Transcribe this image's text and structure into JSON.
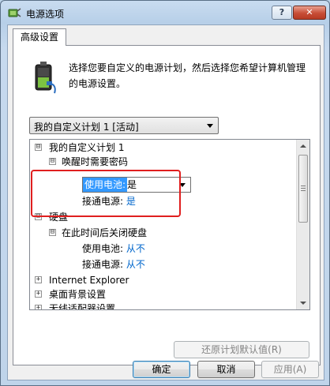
{
  "window": {
    "title": "电源选项",
    "help_label": "?",
    "close_label": "✕"
  },
  "tabs": [
    {
      "label": "高级设置"
    }
  ],
  "description": "选择您要自定义的电源计划，然后选择您希望计算机管理的电源设置。",
  "plan_dropdown": {
    "selected": "我的自定义计划 1 [活动]"
  },
  "tree": {
    "plan": {
      "label": "我的自定义计划 1",
      "expander": "⊟"
    },
    "wake_password": {
      "label": "唤醒时需要密码",
      "battery_label": "使用电池:",
      "battery_value": "是",
      "plugged_label": "接通电源:",
      "plugged_value": "是"
    },
    "hard_disk": {
      "label": "硬盘"
    },
    "disk_off": {
      "label": "在此时间后关闭硬盘",
      "battery_label": "使用电池:",
      "battery_value": "从不",
      "plugged_label": "接通电源:",
      "plugged_value": "从不"
    },
    "collapsed": [
      {
        "label": "Internet Explorer"
      },
      {
        "label": "桌面背景设置"
      },
      {
        "label": "无线适配器设置"
      }
    ]
  },
  "buttons": {
    "restore": "还原计划默认值(R)",
    "ok": "确定",
    "cancel": "取消",
    "apply": "应用(A)"
  },
  "colors": {
    "value_link": "#0066cc",
    "highlight_box": "#e01f1f",
    "selection": "#3399ff"
  },
  "icons": {
    "title": "power-options-icon",
    "battery": "battery-plug-icon"
  }
}
